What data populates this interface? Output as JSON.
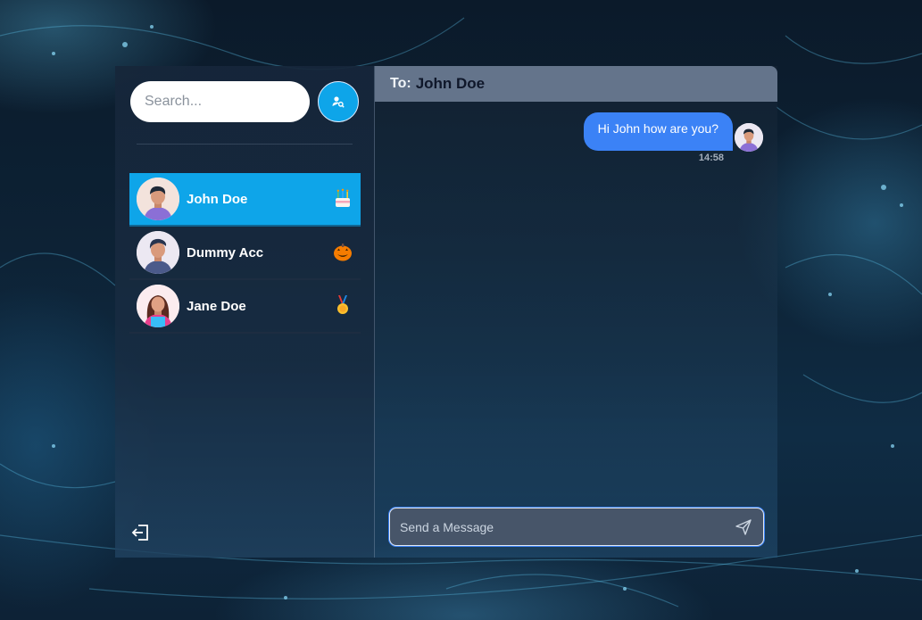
{
  "search": {
    "placeholder": "Search...",
    "button_icon": "user-search-icon"
  },
  "contacts": [
    {
      "name": "John Doe",
      "emoji": "birthday-cake-icon",
      "active": true
    },
    {
      "name": "Dummy Acc",
      "emoji": "jack-o-lantern-icon",
      "active": false
    },
    {
      "name": "Jane Doe",
      "emoji": "medal-icon",
      "active": false
    }
  ],
  "sidebar_footer": {
    "logout_icon": "logout-icon"
  },
  "chat": {
    "to_label": "To:",
    "recipient": "John Doe",
    "messages": [
      {
        "text": "Hi John how are you?",
        "time": "14:58",
        "outgoing": true
      }
    ],
    "composer_placeholder": "Send a Message",
    "send_icon": "send-icon"
  },
  "colors": {
    "accent": "#0ea5e9",
    "bubble": "#3b82f6",
    "header": "#64748b",
    "composer": "#475569"
  }
}
